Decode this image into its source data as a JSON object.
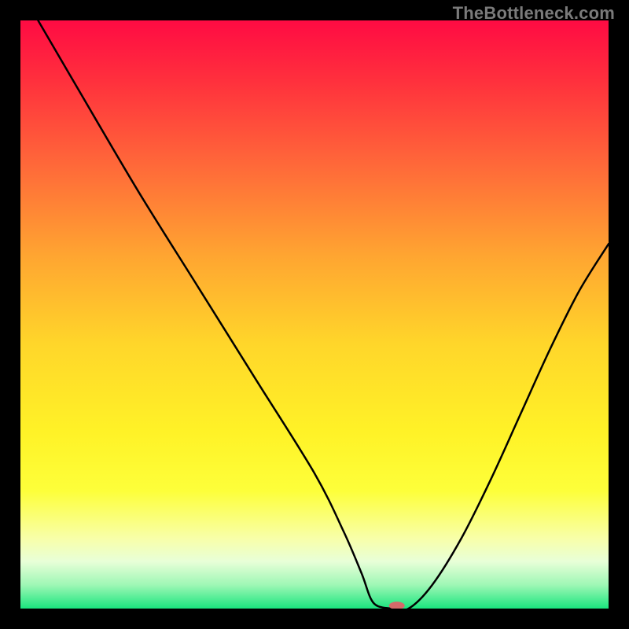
{
  "watermark": "TheBottleneck.com",
  "chart_data": {
    "type": "line",
    "title": "",
    "xlabel": "",
    "ylabel": "",
    "xlim": [
      0,
      100
    ],
    "ylim": [
      0,
      100
    ],
    "grid": false,
    "series": [
      {
        "name": "bottleneck-curve",
        "x": [
          3,
          10,
          20,
          30,
          40,
          50,
          55,
          58,
          60,
          63,
          66,
          70,
          75,
          80,
          85,
          90,
          95,
          100
        ],
        "values": [
          100,
          88,
          71,
          55,
          39,
          23,
          13,
          6,
          1,
          0,
          0,
          4,
          12,
          22,
          33,
          44,
          54,
          62
        ],
        "color": "#000000"
      }
    ],
    "marker": {
      "name": "optimal-point",
      "x": 64,
      "y": 0.5,
      "color": "#d46a6a",
      "rx": 10,
      "ry": 5
    },
    "background_gradient": {
      "description": "vertical rainbow gradient, red top to green bottom with narrow pale band near bottom",
      "stops": [
        {
          "offset": 0.0,
          "color": "#ff0b43"
        },
        {
          "offset": 0.1,
          "color": "#ff2f3d"
        },
        {
          "offset": 0.25,
          "color": "#ff6a39"
        },
        {
          "offset": 0.4,
          "color": "#ffa531"
        },
        {
          "offset": 0.55,
          "color": "#ffd62a"
        },
        {
          "offset": 0.7,
          "color": "#fff227"
        },
        {
          "offset": 0.8,
          "color": "#fdff3a"
        },
        {
          "offset": 0.88,
          "color": "#f8ffa8"
        },
        {
          "offset": 0.92,
          "color": "#e8ffd8"
        },
        {
          "offset": 0.96,
          "color": "#9ef7b5"
        },
        {
          "offset": 1.0,
          "color": "#1ae57e"
        }
      ]
    }
  }
}
